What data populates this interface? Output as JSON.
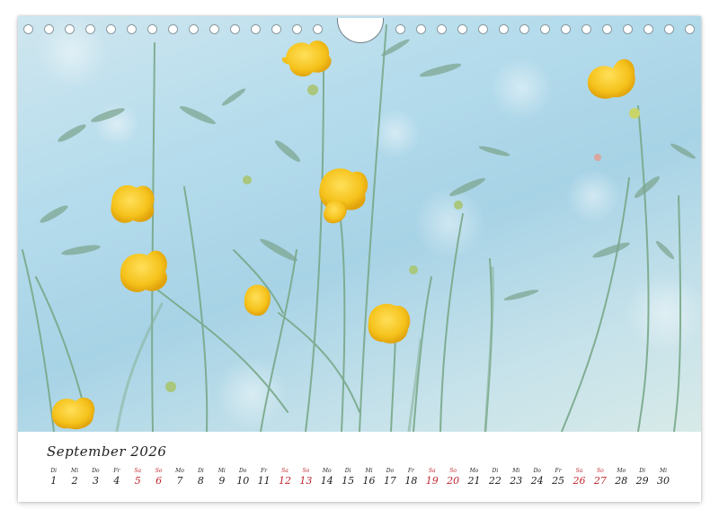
{
  "calendar": {
    "month_title": "September 2026",
    "weekend_color": "#c0272d",
    "text_color": "#1f1f1f",
    "days": [
      {
        "name": "Di",
        "num": "1",
        "weekend": false
      },
      {
        "name": "Mi",
        "num": "2",
        "weekend": false
      },
      {
        "name": "Do",
        "num": "3",
        "weekend": false
      },
      {
        "name": "Fr",
        "num": "4",
        "weekend": false
      },
      {
        "name": "Sa",
        "num": "5",
        "weekend": true
      },
      {
        "name": "So",
        "num": "6",
        "weekend": true
      },
      {
        "name": "Mo",
        "num": "7",
        "weekend": false
      },
      {
        "name": "Di",
        "num": "8",
        "weekend": false
      },
      {
        "name": "Mi",
        "num": "9",
        "weekend": false
      },
      {
        "name": "Do",
        "num": "10",
        "weekend": false
      },
      {
        "name": "Fr",
        "num": "11",
        "weekend": false
      },
      {
        "name": "Sa",
        "num": "12",
        "weekend": true
      },
      {
        "name": "So",
        "num": "13",
        "weekend": true
      },
      {
        "name": "Mo",
        "num": "14",
        "weekend": false
      },
      {
        "name": "Di",
        "num": "15",
        "weekend": false
      },
      {
        "name": "Mi",
        "num": "16",
        "weekend": false
      },
      {
        "name": "Do",
        "num": "17",
        "weekend": false
      },
      {
        "name": "Fr",
        "num": "18",
        "weekend": false
      },
      {
        "name": "Sa",
        "num": "19",
        "weekend": true
      },
      {
        "name": "So",
        "num": "20",
        "weekend": true
      },
      {
        "name": "Mo",
        "num": "21",
        "weekend": false
      },
      {
        "name": "Di",
        "num": "22",
        "weekend": false
      },
      {
        "name": "Mi",
        "num": "23",
        "weekend": false
      },
      {
        "name": "Do",
        "num": "24",
        "weekend": false
      },
      {
        "name": "Fr",
        "num": "25",
        "weekend": false
      },
      {
        "name": "Sa",
        "num": "26",
        "weekend": true
      },
      {
        "name": "So",
        "num": "27",
        "weekend": true
      },
      {
        "name": "Mo",
        "num": "28",
        "weekend": false
      },
      {
        "name": "Di",
        "num": "29",
        "weekend": false
      },
      {
        "name": "Mi",
        "num": "30",
        "weekend": false
      }
    ]
  },
  "photo": {
    "subject": "buttercup-meadow-icon",
    "sky_color": "#a7d3e6",
    "flower_color": "#f5c21b",
    "stem_color": "#6f9e7c"
  },
  "binding": {
    "hole_count": 32
  }
}
